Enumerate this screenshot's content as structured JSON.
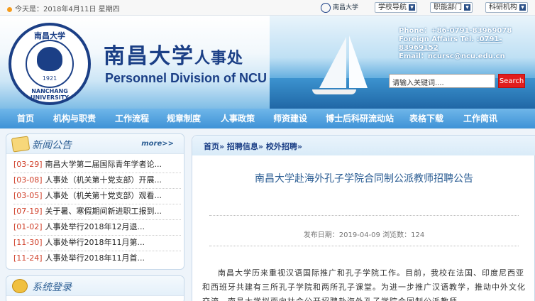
{
  "topbar": {
    "date_text": "今天是：2018年4月11日  星期四",
    "logo_text": "南昌大学",
    "dropdowns": [
      "学校导航",
      "职能部门",
      "科研机构"
    ]
  },
  "banner": {
    "emblem_top": "南昌大学",
    "emblem_bottom": "NANCHANG UNIVERSITY",
    "emblem_year": "1921",
    "title_cn": "南昌大学",
    "title_cn_suffix": "人事处",
    "title_en": "Personnel Division of NCU",
    "phone": "Phone：+86-0791-83969078",
    "fax_label": "Foreign Affairs Tel. ",
    "fax_value": "0791-83969152",
    "email": "Email：ncursc@ncu.edu.cn",
    "search_placeholder": "请输入关键词....",
    "search_button": "Search"
  },
  "nav": [
    "首页",
    "机构与职责",
    "工作流程",
    "规章制度",
    "人事政策",
    "师资建设",
    "博士后科研流动站",
    "表格下载",
    "工作简讯"
  ],
  "news": {
    "title": "新闻公告",
    "more": "more>>",
    "items": [
      {
        "date": "[03-29]",
        "text": "南昌大学第二届国际青年学者论..."
      },
      {
        "date": "[03-08]",
        "text": "人事处（机关第十党支部）开展..."
      },
      {
        "date": "[03-05]",
        "text": "人事处（机关第十党支部）观看..."
      },
      {
        "date": "[07-19]",
        "text": "关于暑、寒假期间新进职工报到..."
      },
      {
        "date": "[01-02]",
        "text": "人事处举行2018年12月退..."
      },
      {
        "date": "[11-30]",
        "text": "人事处举行2018年11月第..."
      },
      {
        "date": "[11-24]",
        "text": "人事处举行2018年11月首..."
      }
    ]
  },
  "login": {
    "title": "系统登录"
  },
  "article": {
    "breadcrumb": "首页» 招聘信息» 校外招聘»",
    "title": "南昌大学赴海外孔子学院合同制公派教师招聘公告",
    "meta": "发布日期：2019-04-09  浏览数：124",
    "body": "南昌大学历来重视汉语国际推广和孔子学院工作。目前，我校在法国、印度尼西亚和西班牙共建有三所孔子学院和两所孔子课堂。为进一步推广汉语教学，推动中外文化交流，南昌大学拟面向社会公开招聘赴海外孔子学院合同制公派教师。"
  }
}
